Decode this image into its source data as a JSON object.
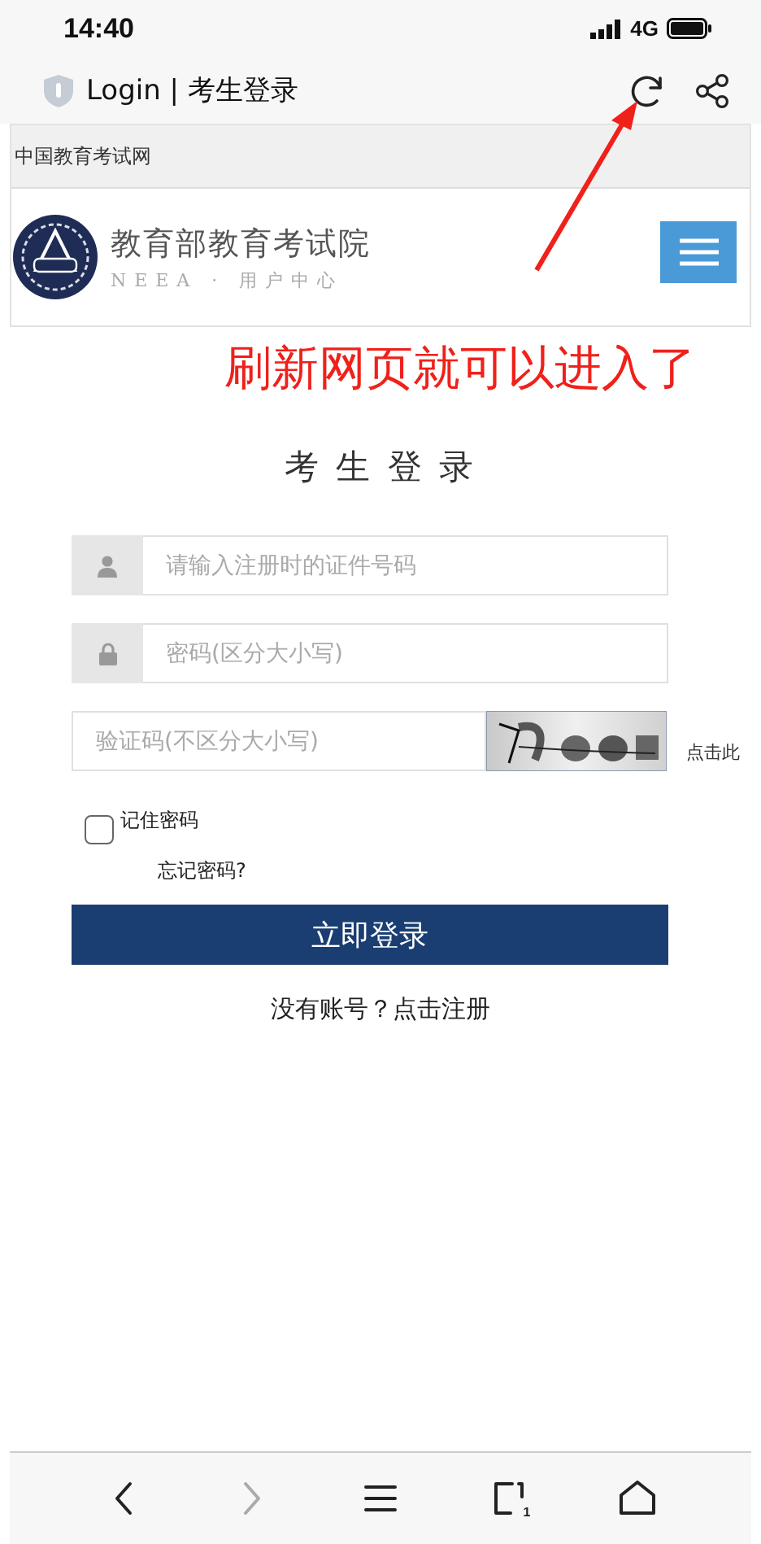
{
  "status_bar": {
    "time": "14:40",
    "network": "4G"
  },
  "browser": {
    "title": "Login | 考生登录"
  },
  "site": {
    "top_strip": "中国教育考试网",
    "org_name": "教育部教育考试院",
    "org_sub": "NEEA · 用户中心"
  },
  "annotation": {
    "text": "刷新网页就可以进入了"
  },
  "login": {
    "title": "考 生 登 录",
    "fields": [
      {
        "kind": "user",
        "placeholder": "请输入注册时的证件号码"
      },
      {
        "kind": "lock",
        "placeholder": "密码(区分大小写)"
      },
      {
        "kind": "captcha",
        "placeholder": "验证码(不区分大小写)",
        "refresh_hint": "点击此"
      }
    ],
    "remember": {
      "label": "记住密码",
      "checked": false
    },
    "forgot": "忘记密码?",
    "submit": "立即登录",
    "register": "没有账号？点击注册"
  },
  "toolbar": {
    "items": [
      {
        "kind": "back",
        "disabled": false
      },
      {
        "kind": "forward",
        "disabled": true
      },
      {
        "kind": "menu",
        "disabled": false
      },
      {
        "kind": "tabs",
        "disabled": false,
        "count": "1"
      },
      {
        "kind": "home",
        "disabled": false
      }
    ]
  }
}
